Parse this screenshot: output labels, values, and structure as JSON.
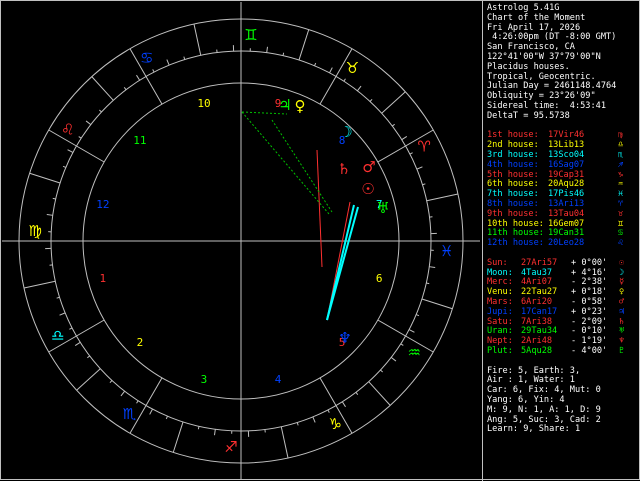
{
  "header": [
    "Astrolog 5.41G",
    "Chart of the Moment",
    "Fri April 17, 2026",
    " 4:26:00pm (DT -8:00 GMT)",
    "San Francisco, CA",
    "122°41'00\"W 37°79'00\"N",
    "Placidus houses.",
    "Tropical, Geocentric.",
    "Julian Day = 2461148.4764",
    "Obliquity = 23°26'09\"",
    "Sidereal time:  4:53:41",
    "DeltaT = 95.5738"
  ],
  "houses": [
    {
      "name": "1st house:",
      "pos": "17Vir46",
      "color": "#ff3030",
      "glyph": "♍"
    },
    {
      "name": "2nd house:",
      "pos": "13Lib13",
      "color": "#ffff00",
      "glyph": "♎"
    },
    {
      "name": "3rd house:",
      "pos": "13Sco04",
      "color": "#00ffff",
      "glyph": "♏"
    },
    {
      "name": "4th house:",
      "pos": "16Sag07",
      "color": "#0040ff",
      "glyph": "♐"
    },
    {
      "name": "5th house:",
      "pos": "19Cap31",
      "color": "#ff3030",
      "glyph": "♑"
    },
    {
      "name": "6th house:",
      "pos": "20Aqu28",
      "color": "#ffff00",
      "glyph": "♒"
    },
    {
      "name": "7th house:",
      "pos": "17Pis46",
      "color": "#00ffff",
      "glyph": "♓"
    },
    {
      "name": "8th house:",
      "pos": "13Ari13",
      "color": "#0040ff",
      "glyph": "♈"
    },
    {
      "name": "9th house:",
      "pos": "13Tau04",
      "color": "#ff3030",
      "glyph": "♉"
    },
    {
      "name": "10th house:",
      "pos": "16Gem07",
      "color": "#ffff00",
      "glyph": "♊"
    },
    {
      "name": "11th house:",
      "pos": "19Can31",
      "color": "#00ff00",
      "glyph": "♋"
    },
    {
      "name": "12th house:",
      "pos": "20Leo28",
      "color": "#0040ff",
      "glyph": "♌"
    }
  ],
  "planets": [
    {
      "name": "Sun:",
      "pos": "27Ari57",
      "speed": "+ 0°00'",
      "color": "#ff3030",
      "glyph": "☉"
    },
    {
      "name": "Moon:",
      "pos": "4Tau37",
      "speed": "+ 4°16'",
      "color": "#00ffff",
      "glyph": "☽"
    },
    {
      "name": "Merc:",
      "pos": "4Ari07",
      "speed": "- 2°38'",
      "color": "#ff3030",
      "glyph": "☿"
    },
    {
      "name": "Venu:",
      "pos": "22Tau27",
      "speed": "+ 0°18'",
      "color": "#ffff00",
      "glyph": "♀"
    },
    {
      "name": "Mars:",
      "pos": "6Ari20",
      "speed": "- 0°58'",
      "color": "#ff3030",
      "glyph": "♂"
    },
    {
      "name": "Jupi:",
      "pos": "17Can17",
      "speed": "+ 0°23'",
      "color": "#0040ff",
      "glyph": "♃"
    },
    {
      "name": "Satu:",
      "pos": "7Ari38",
      "speed": "- 2°09'",
      "color": "#ff3030",
      "glyph": "♄"
    },
    {
      "name": "Uran:",
      "pos": "29Tau34",
      "speed": "- 0°10'",
      "color": "#00ff00",
      "glyph": "♅"
    },
    {
      "name": "Nept:",
      "pos": "2Ari48",
      "speed": "- 1°19'",
      "color": "#ff3030",
      "glyph": "♆"
    },
    {
      "name": "Plut:",
      "pos": "5Aqu28",
      "speed": "- 4°00'",
      "color": "#00ff00",
      "glyph": "♇"
    }
  ],
  "summary": [
    "Fire: 5, Earth: 3,",
    "Air : 1, Water: 1",
    "Car: 6, Fix: 4, Mut: 0",
    "Yang: 6, Yin: 4",
    "M: 9, N: 1, A: 1, D: 9",
    "Ang: 5, Suc: 3, Cad: 2",
    "Learn: 9, Share: 1"
  ],
  "wheel": {
    "house_numbers": [
      "1",
      "2",
      "3",
      "4",
      "5",
      "6",
      "7",
      "8",
      "9",
      "10",
      "11",
      "12"
    ],
    "house_number_colors": [
      "#ff3030",
      "#ffff00",
      "#00ff00",
      "#0040ff",
      "#ff3030",
      "#ffff00",
      "#00ffff",
      "#0040ff",
      "#ff3030",
      "#ffff00",
      "#00ff00",
      "#0040ff"
    ],
    "house_cusp_degrees": [
      "17",
      "13",
      "13",
      "16",
      "19",
      "20",
      "17",
      "13",
      "13",
      "16",
      "19",
      "20"
    ],
    "sign_glyphs": [
      "♈",
      "♉",
      "♊",
      "♋",
      "♌",
      "♍",
      "♎",
      "♏",
      "♐",
      "♑",
      "♒",
      "♓"
    ],
    "sign_colors": [
      "#ff3030",
      "#ffff00",
      "#00ff00",
      "#0040ff",
      "#ff3030",
      "#ffff00",
      "#00ffff",
      "#0040ff",
      "#ff3030",
      "#ffff00",
      "#00ff00",
      "#0040ff"
    ]
  },
  "colors": {
    "fg": "#ffffff",
    "line": "#c0c0c0"
  }
}
